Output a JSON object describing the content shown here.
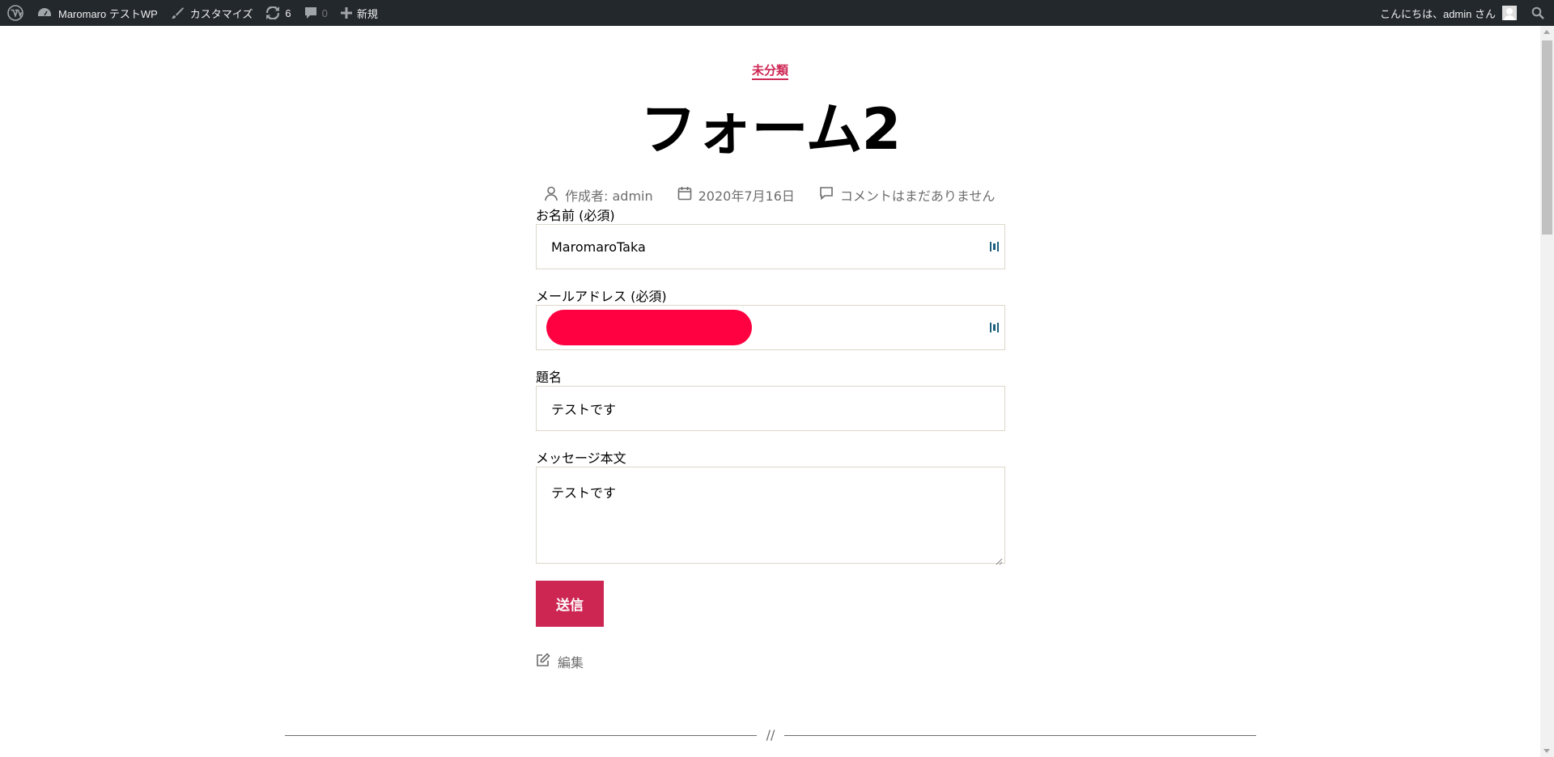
{
  "adminbar": {
    "site_name": "Maromaro テストWP",
    "customize": "カスタマイズ",
    "updates_count": "6",
    "comments_count": "0",
    "new_label": "新規",
    "greeting": "こんにちは、admin さん"
  },
  "post": {
    "category": "未分類",
    "title": "フォーム2",
    "author": "作成者: admin",
    "date": "2020年7月16日",
    "comments": "コメントはまだありません"
  },
  "form": {
    "name_label": "お名前 (必須)",
    "name_value": "MaromaroTaka",
    "email_label": "メールアドレス (必須)",
    "email_value_redacted": true,
    "subject_label": "題名",
    "subject_value": "テストです",
    "message_label": "メッセージ本文",
    "message_value": "テストです",
    "submit_label": "送信"
  },
  "edit_label": "編集",
  "separator": "//",
  "colors": {
    "accent": "#cd2653",
    "adminbar_bg": "#23282d",
    "redaction": "#ff0040"
  }
}
